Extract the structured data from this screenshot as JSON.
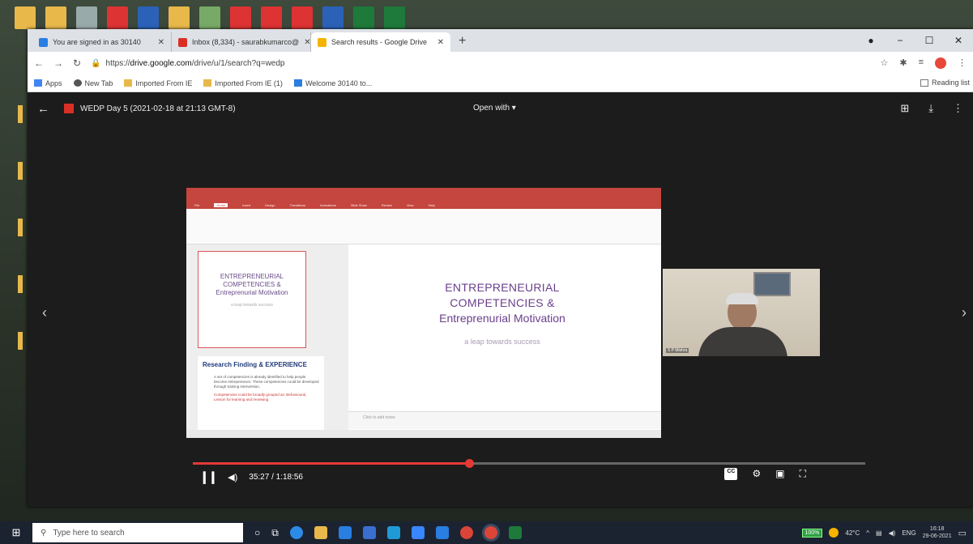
{
  "browser": {
    "tabs": [
      {
        "label": "You are signed in as 30140",
        "fav_color": "#2a7de1",
        "active": false
      },
      {
        "label": "Inbox (8,334) - saurabkumarco@",
        "fav_color": "#d93025",
        "active": false
      },
      {
        "label": "Search results - Google Drive",
        "fav_color": "#f4b400",
        "active": true
      }
    ],
    "new_tab": "+",
    "window_controls": {
      "minimize": "−",
      "maximize": "☐",
      "close": "✕"
    },
    "url_prefix": "https://",
    "url_host": "drive.google.com",
    "url_path": "/drive/u/1/search?q=wedp",
    "bookmarks": [
      "Apps",
      "New Tab",
      "Imported From IE",
      "Imported From IE (1)",
      "Welcome 30140 to..."
    ],
    "reading_list": "Reading list"
  },
  "viewer": {
    "file_title": "WEDP Day 5 (2021-02-18 at 21:13 GMT-8)",
    "open_with": "Open with ▾",
    "slide": {
      "title_line1": "ENTREPRENEURIAL",
      "title_line2": "COMPETENCIES &",
      "title_line3": "Entreprenurial Motivation",
      "subtitle": "a leap towards success"
    },
    "thumb1": {
      "line1": "ENTREPRENEURIAL",
      "line2": "COMPETENCIES &",
      "line3": "Entreprenurial Motivation",
      "sub": "a leap towards success"
    },
    "thumb2": {
      "heading": "Research Finding & EXPERIENCE",
      "bullet1": "A set of competencies is already identified to help people become entrepreneurs. These competencies could be developed through training intervention.",
      "bullet2": "Competencies could be broadly grouped as: Behavioural, Lesson for learning and reviewing"
    },
    "notes": "Click to add notes",
    "webcam_name": "S P Mishra",
    "time_display": "35:27 / 1:18:56",
    "progress_fraction": 0.411
  },
  "taskbar": {
    "search_placeholder": "Type here to search",
    "battery": "100%",
    "temperature": "42°C",
    "language": "ENG",
    "time": "16:18",
    "date": "29-06-2021"
  },
  "colors": {
    "accent_red": "#e53935",
    "slide_purple": "#6a3f8c",
    "ribbon": "#c4463e"
  }
}
